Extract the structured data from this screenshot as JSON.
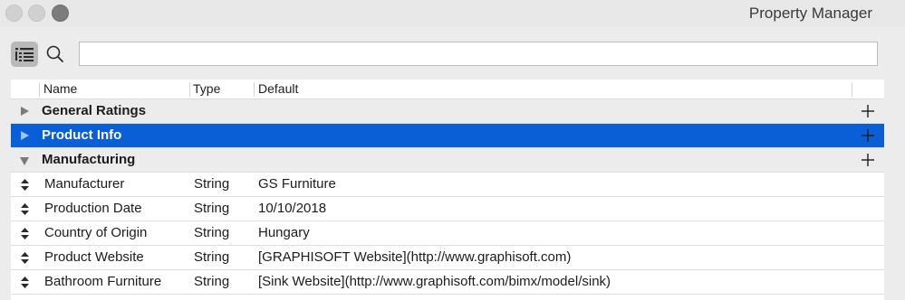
{
  "window": {
    "title": "Property Manager"
  },
  "search": {
    "value": ""
  },
  "table": {
    "columns": {
      "name": "Name",
      "type": "Type",
      "default": "Default"
    },
    "groups": [
      {
        "label": "General Ratings",
        "expanded": false,
        "selected": false
      },
      {
        "label": "Product Info",
        "expanded": false,
        "selected": true
      },
      {
        "label": "Manufacturing",
        "expanded": true,
        "selected": false
      }
    ],
    "properties": [
      {
        "name": "Manufacturer",
        "type": "String",
        "default": "GS Furniture"
      },
      {
        "name": "Production Date",
        "type": "String",
        "default": "10/10/2018"
      },
      {
        "name": "Country of Origin",
        "type": "String",
        "default": "Hungary"
      },
      {
        "name": "Product Website",
        "type": "String",
        "default": "[GRAPHISOFT Website](http://www.graphisoft.com)"
      },
      {
        "name": "Bathroom Furniture",
        "type": "String",
        "default": "[Sink Website](http://www.graphisoft.com/bimx/model/sink)"
      }
    ]
  },
  "colors": {
    "selection": "#0a5fd6",
    "group_bg": "#ececec",
    "window_bg": "#ececec"
  },
  "icons": {
    "view_toggle": "list-view-icon",
    "search": "search-icon",
    "add": "plus-icon",
    "expand": "disclosure-triangle-icon",
    "stepper": "up-down-stepper-icon"
  }
}
